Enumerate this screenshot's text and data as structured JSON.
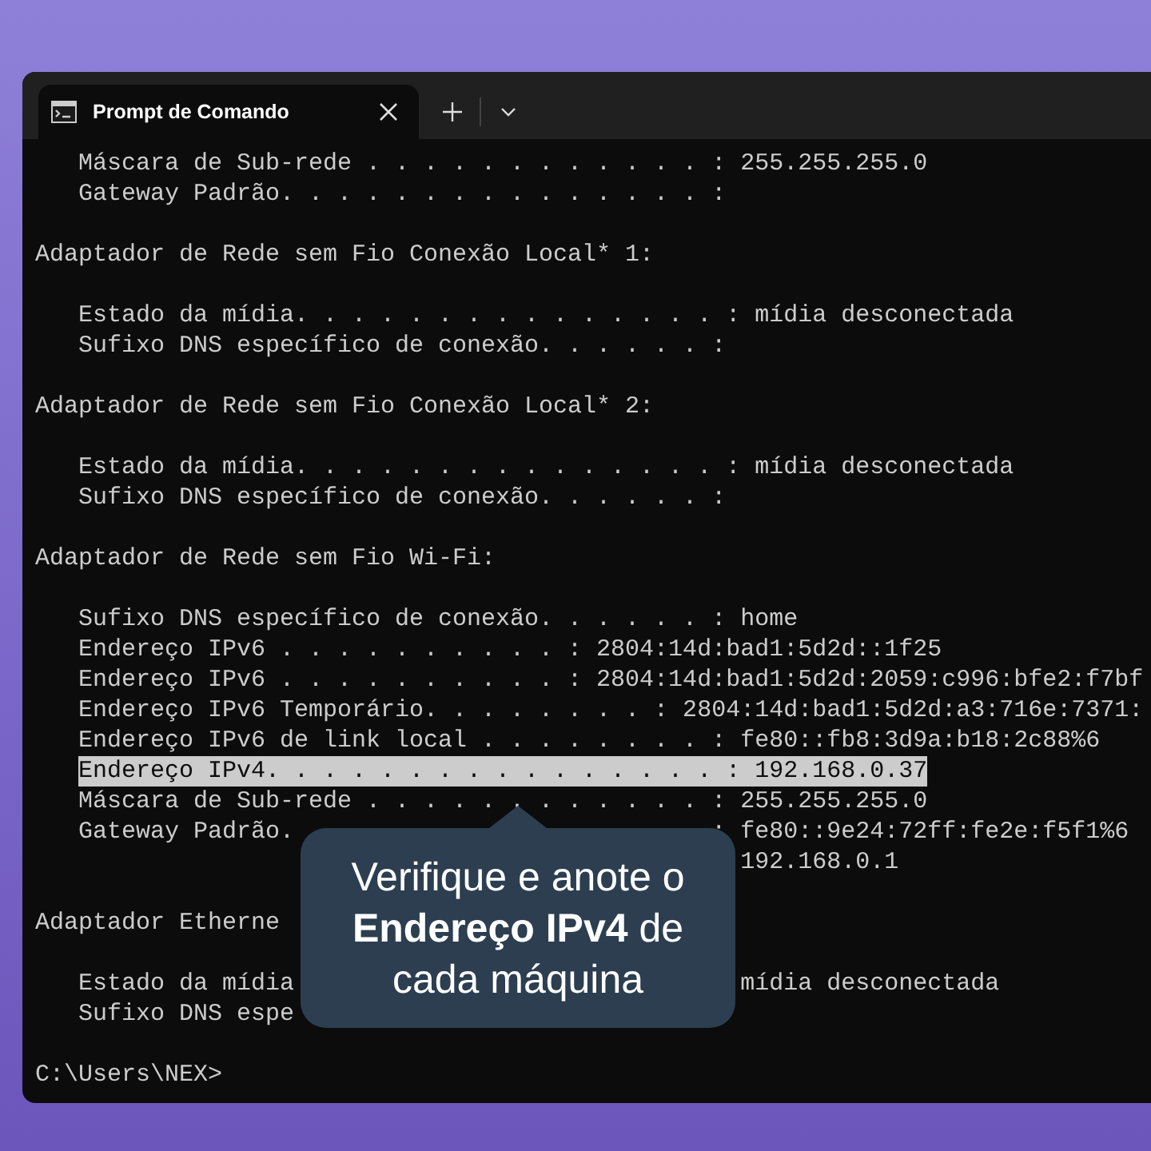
{
  "window": {
    "tab": {
      "title": "Prompt de Comando",
      "selected": true
    }
  },
  "terminal": {
    "lines": [
      {
        "kind": "field",
        "text": "Máscara de Sub-rede . . . . . . . . . . . . : 255.255.255.0",
        "selected": false
      },
      {
        "kind": "field",
        "text": "Gateway Padrão. . . . . . . . . . . . . . . :",
        "selected": false
      },
      {
        "kind": "blank"
      },
      {
        "kind": "heading",
        "text": "Adaptador de Rede sem Fio Conexão Local* 1:",
        "selected": false
      },
      {
        "kind": "blank"
      },
      {
        "kind": "field",
        "text": "Estado da mídia. . . . . . . . . . . . . . . : mídia desconectada",
        "selected": false
      },
      {
        "kind": "field",
        "text": "Sufixo DNS específico de conexão. . . . . . :",
        "selected": false
      },
      {
        "kind": "blank"
      },
      {
        "kind": "heading",
        "text": "Adaptador de Rede sem Fio Conexão Local* 2:",
        "selected": false
      },
      {
        "kind": "blank"
      },
      {
        "kind": "field",
        "text": "Estado da mídia. . . . . . . . . . . . . . . : mídia desconectada",
        "selected": false
      },
      {
        "kind": "field",
        "text": "Sufixo DNS específico de conexão. . . . . . :",
        "selected": false
      },
      {
        "kind": "blank"
      },
      {
        "kind": "heading",
        "text": "Adaptador de Rede sem Fio Wi-Fi:",
        "selected": false
      },
      {
        "kind": "blank"
      },
      {
        "kind": "field",
        "text": "Sufixo DNS específico de conexão. . . . . . : home",
        "selected": false
      },
      {
        "kind": "field",
        "text": "Endereço IPv6 . . . . . . . . . . : 2804:14d:bad1:5d2d::1f25",
        "selected": false
      },
      {
        "kind": "field",
        "text": "Endereço IPv6 . . . . . . . . . . : 2804:14d:bad1:5d2d:2059:c996:bfe2:f7bf",
        "selected": false
      },
      {
        "kind": "field",
        "text": "Endereço IPv6 Temporário. . . . . . . . : 2804:14d:bad1:5d2d:a3:716e:7371:",
        "selected": false
      },
      {
        "kind": "field",
        "text": "Endereço IPv6 de link local . . . . . . . . : fe80::fb8:3d9a:b18:2c88%6",
        "selected": false
      },
      {
        "kind": "field",
        "text": "Endereço IPv4. . . . . . . . . . . . . . . . : 192.168.0.37",
        "selected": true
      },
      {
        "kind": "field",
        "text": "Máscara de Sub-rede . . . . . . . . . . . . : 255.255.255.0",
        "selected": false
      },
      {
        "kind": "field",
        "text": "Gateway Padrão.",
        "tail": ": fe80::9e24:72ff:fe2e:f5f1%6",
        "selected": false
      },
      {
        "kind": "field",
        "value": "192.168.0.1",
        "selected": false
      },
      {
        "kind": "blank"
      },
      {
        "kind": "heading",
        "text": "Adaptador Etherne",
        "selected": false
      },
      {
        "kind": "blank"
      },
      {
        "kind": "field",
        "text": "Estado da mídia",
        "value": "mídia desconectada",
        "selected": false
      },
      {
        "kind": "field",
        "text": "Sufixo DNS espe",
        "selected": false
      },
      {
        "kind": "blank"
      },
      {
        "kind": "heading",
        "text": "C:\\Users\\NEX>",
        "selected": false
      }
    ]
  },
  "callout": {
    "text": "Verifique e anote o **Endereço IPv4** de cada máquina"
  }
}
